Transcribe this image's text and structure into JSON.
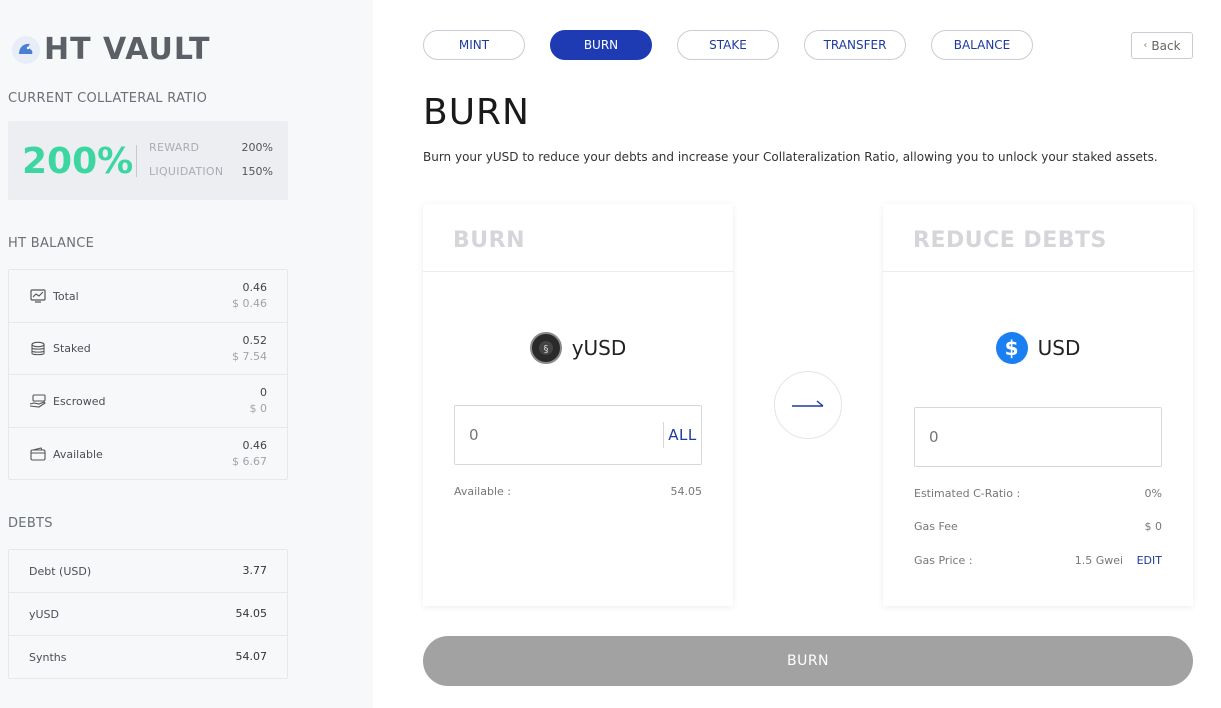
{
  "sidebar": {
    "brand": "HT VAULT",
    "collateral_label": "CURRENT COLLATERAL RATIO",
    "ratio": {
      "value": "200%",
      "reward_label": "REWARD",
      "reward_value": "200%",
      "liquidation_label": "LIQUIDATION",
      "liquidation_value": "150%"
    },
    "balance_label": "HT BALANCE",
    "balance_rows": [
      {
        "label": "Total",
        "icon": "monitor-icon",
        "value": "0.46",
        "usd": "$ 0.46"
      },
      {
        "label": "Staked",
        "icon": "database-icon",
        "value": "0.52",
        "usd": "$ 7.54"
      },
      {
        "label": "Escrowed",
        "icon": "hand-coin-icon",
        "value": "0",
        "usd": "$ 0"
      },
      {
        "label": "Available",
        "icon": "wallet-icon",
        "value": "0.46",
        "usd": "$ 6.67"
      }
    ],
    "debts_label": "DEBTS",
    "debt_rows": [
      {
        "label": "Debt (USD)",
        "value": "3.77"
      },
      {
        "label": "yUSD",
        "value": "54.05"
      },
      {
        "label": "Synths",
        "value": "54.07"
      }
    ]
  },
  "tabs": [
    "MINT",
    "BURN",
    "STAKE",
    "TRANSFER",
    "BALANCE"
  ],
  "active_tab": "BURN",
  "back_label": "Back",
  "page": {
    "title": "BURN",
    "description": "Burn your yUSD to reduce your debts and increase your Collateralization Ratio, allowing you to unlock your staked assets."
  },
  "burn_panel": {
    "header": "BURN",
    "token": "yUSD",
    "input_placeholder": "0",
    "all_label": "ALL",
    "available_label": "Available :",
    "available_value": "54.05"
  },
  "reduce_panel": {
    "header": "REDUCE DEBTS",
    "token": "USD",
    "input_placeholder": "0",
    "cratio_label": "Estimated C-Ratio :",
    "cratio_value": "0%",
    "gas_fee_label": "Gas Fee",
    "gas_fee_value": "$ 0",
    "gas_price_label": "Gas Price :",
    "gas_price_value": "1.5 Gwei",
    "edit_label": "EDIT"
  },
  "submit_label": "BURN",
  "colors": {
    "accent": "#1f3bb3",
    "ratio_green": "#3dd6a0",
    "usd_blue": "#1a7ff0",
    "button_grey": "#a2a2a2"
  }
}
